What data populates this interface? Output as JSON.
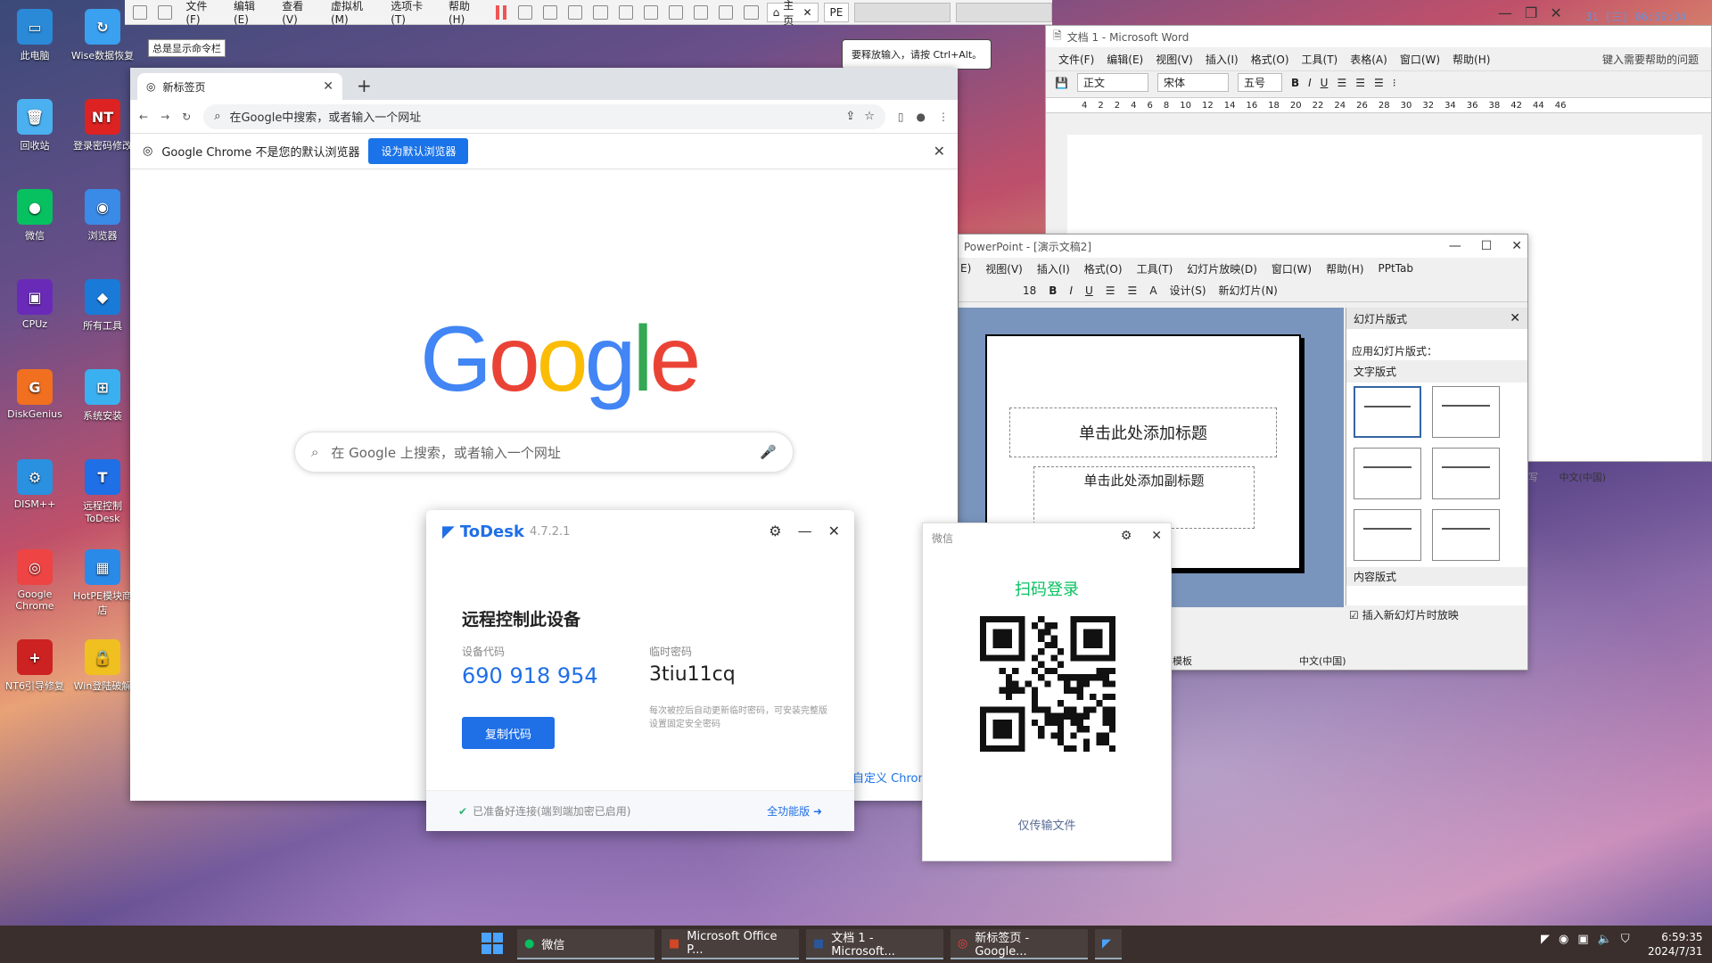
{
  "vm": {
    "menu": [
      "文件(F)",
      "编辑(E)",
      "查看(V)",
      "虚拟机(M)",
      "选项卡(T)",
      "帮助(H)"
    ],
    "tab_home": "主页",
    "tab_pe": "PE",
    "clock": "31 [三] 06:59:34",
    "tooltip_cmd": "总是显示命令栏",
    "tooltip_release": "要释放输入，请按 Ctrl+Alt。"
  },
  "desktop": {
    "icons": [
      {
        "label": "此电脑",
        "color": "#2a8ad8",
        "glyph": "▭"
      },
      {
        "label": "Wise数据恢复",
        "color": "#3aa0f0",
        "glyph": "↻"
      },
      {
        "label": "回收站",
        "color": "#4ab0f0",
        "glyph": "🗑"
      },
      {
        "label": "登录密码修改",
        "color": "#d22",
        "glyph": "NT"
      },
      {
        "label": "微信",
        "color": "#07c160",
        "glyph": "●"
      },
      {
        "label": "浏览器",
        "color": "#3a8ae8",
        "glyph": "◉"
      },
      {
        "label": "CPUz",
        "color": "#6a2ab8",
        "glyph": "▣"
      },
      {
        "label": "所有工具",
        "color": "#1a7ad8",
        "glyph": "◆"
      },
      {
        "label": "DiskGenius",
        "color": "#f07020",
        "glyph": "G"
      },
      {
        "label": "系统安装",
        "color": "#3ab0f0",
        "glyph": "⊞"
      },
      {
        "label": "DISM++",
        "color": "#2a90e0",
        "glyph": "⚙"
      },
      {
        "label": "远程控制ToDesk",
        "color": "#1f6fe6",
        "glyph": "T"
      },
      {
        "label": "Google Chrome",
        "color": "#e44",
        "glyph": "◎"
      },
      {
        "label": "HotPE模块商店",
        "color": "#2a8ae8",
        "glyph": "▦"
      },
      {
        "label": "NT6引导修复",
        "color": "#c22",
        "glyph": "+"
      },
      {
        "label": "Win登陆破解",
        "color": "#f0c020",
        "glyph": "🔒"
      }
    ]
  },
  "chrome": {
    "tab_title": "新标签页",
    "omnibox": "在Google中搜索，或者输入一个网址",
    "infobar_text": "Google Chrome 不是您的默认浏览器",
    "infobar_button": "设为默认浏览器",
    "search_placeholder": "在 Google 上搜索，或者输入一个网址",
    "customize": "自定义 Chrom"
  },
  "word": {
    "title": "文档 1 - Microsoft Word",
    "menu": [
      "文件(F)",
      "编辑(E)",
      "视图(V)",
      "插入(I)",
      "格式(O)",
      "工具(T)",
      "表格(A)",
      "窗口(W)",
      "帮助(H)"
    ],
    "help_box": "键入需要帮助的问题",
    "style": "正文",
    "font": "宋体",
    "size": "五号",
    "ruler": [
      "4",
      "2",
      "2",
      "4",
      "6",
      "8",
      "10",
      "12",
      "14",
      "16",
      "18",
      "20",
      "22",
      "24",
      "26",
      "28",
      "30",
      "32",
      "34",
      "36",
      "38",
      "42",
      "44",
      "46"
    ],
    "status": [
      "改写",
      "中文(中国)"
    ]
  },
  "ppt": {
    "title": "PowerPoint - [演示文稿2]",
    "menu": [
      "E)",
      "视图(V)",
      "插入(I)",
      "格式(O)",
      "工具(T)",
      "幻灯片放映(D)",
      "窗口(W)",
      "帮助(H)",
      "PPtTab"
    ],
    "font_size": "18",
    "design": "设计(S)",
    "new_slide": "新幻灯片(N)",
    "title_placeholder": "单击此处添加标题",
    "subtitle_placeholder": "单击此处添加副标题",
    "pane_title": "幻灯片版式",
    "apply_label": "应用幻灯片版式：",
    "text_layouts": "文字版式",
    "content_layouts": "内容版式",
    "show_on_insert": "插入新幻灯片时放映",
    "status_template": "模板",
    "status_lang": "中文(中国)"
  },
  "todesk": {
    "brand": "ToDesk",
    "version": "4.7.2.1",
    "heading": "远程控制此设备",
    "device_label": "设备代码",
    "device_code": "690 918 954",
    "pwd_label": "临时密码",
    "pwd": "3tiu11cq",
    "note": "每次被控后自动更新临时密码，可安装完整版设置固定安全密码",
    "copy_button": "复制代码",
    "footer": "已准备好连接(端到端加密已启用)",
    "full": "全功能版"
  },
  "wechat": {
    "title": "微信",
    "scan": "扫码登录",
    "files": "仅传输文件"
  },
  "taskbar": {
    "items": [
      "微信",
      "Microsoft Office P...",
      "文档 1 - Microsoft...",
      "新标签页 - Google..."
    ],
    "time": "6:59:35",
    "date": "2024/7/31"
  }
}
